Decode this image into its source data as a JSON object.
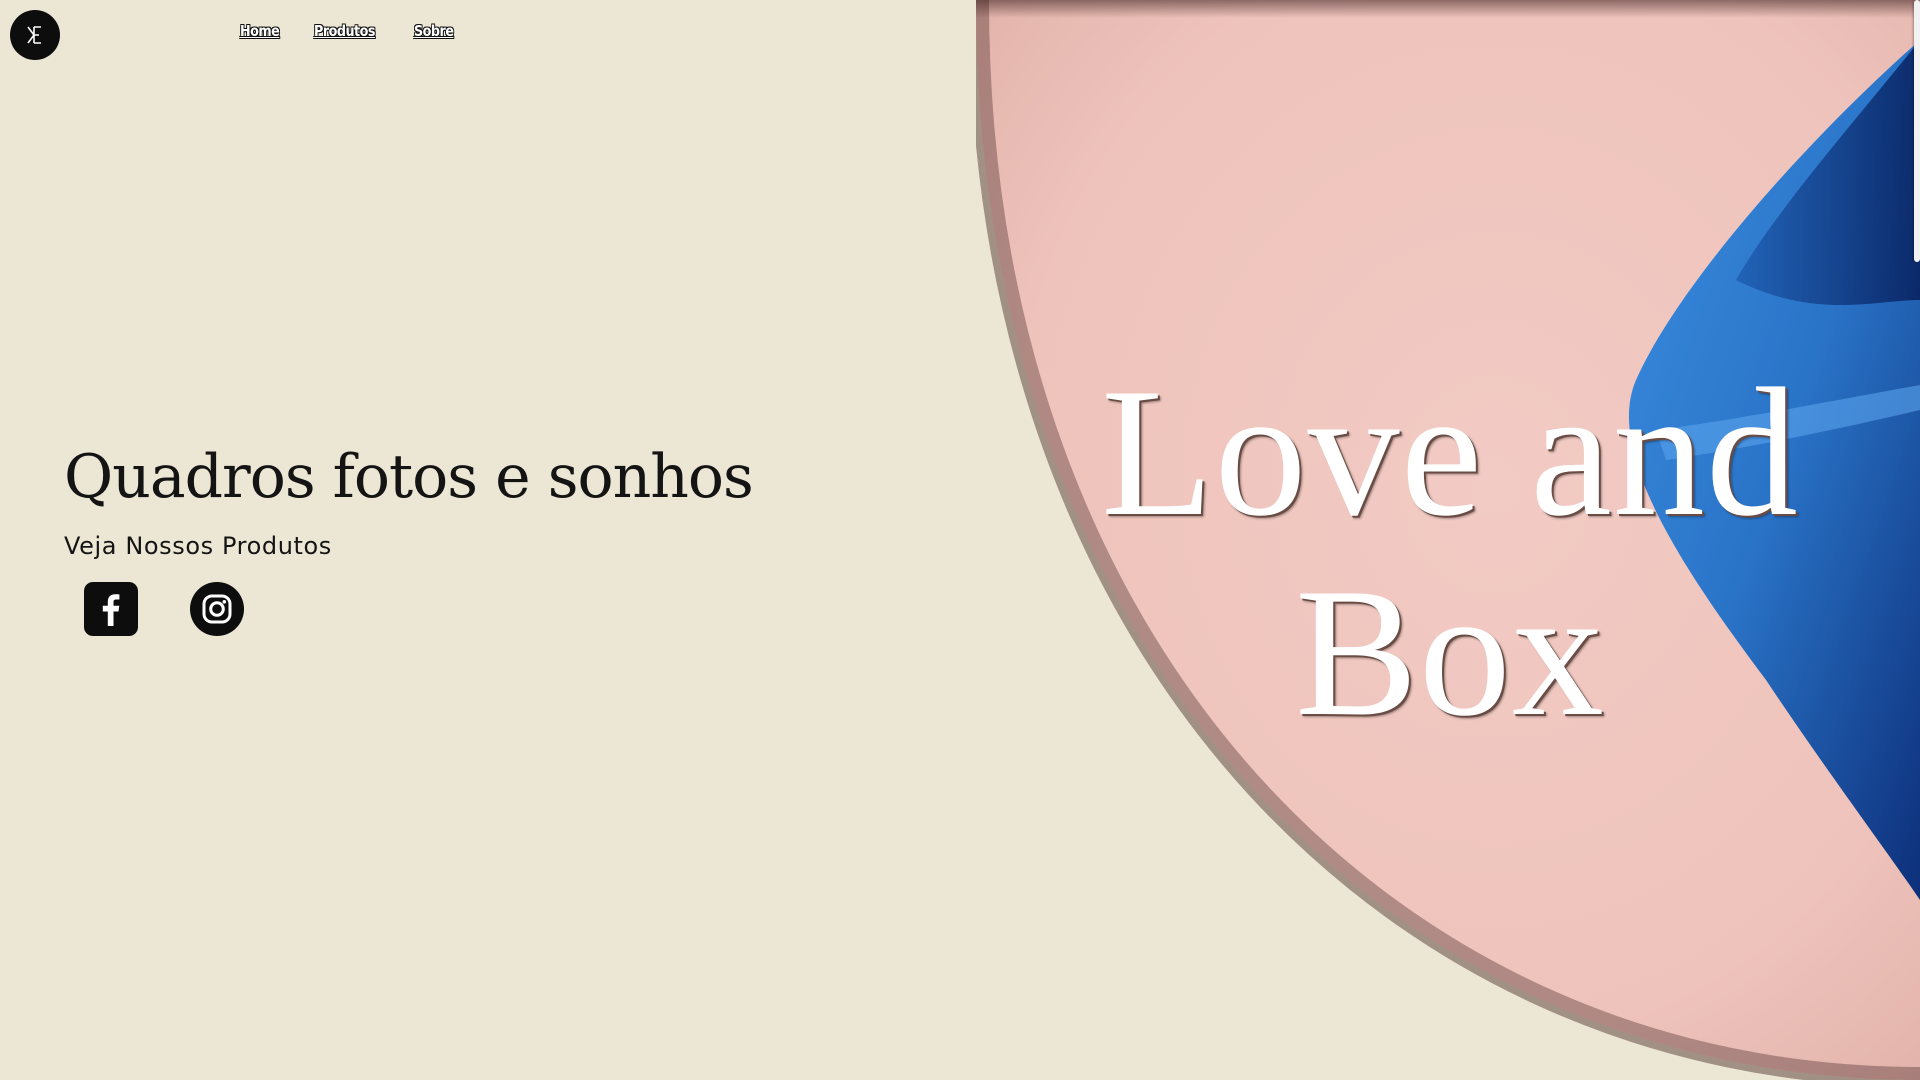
{
  "header": {
    "logo_icon": "monogram-logo-icon",
    "nav": [
      {
        "label": "Home"
      },
      {
        "label": "Produtos"
      },
      {
        "label": "Sobre"
      }
    ]
  },
  "hero": {
    "title": "Quadros fotos e sonhos",
    "subtitle": "Veja Nossos Produtos",
    "social": [
      {
        "icon": "facebook-icon"
      },
      {
        "icon": "instagram-icon"
      }
    ],
    "brand_line_1": "Love and",
    "brand_line_2": "Box"
  },
  "colors": {
    "background": "#ece6d4",
    "panel_pink": "#efc6bf",
    "accent_blue": "#2f7bd0",
    "icon_dark": "#0d0d0d"
  }
}
